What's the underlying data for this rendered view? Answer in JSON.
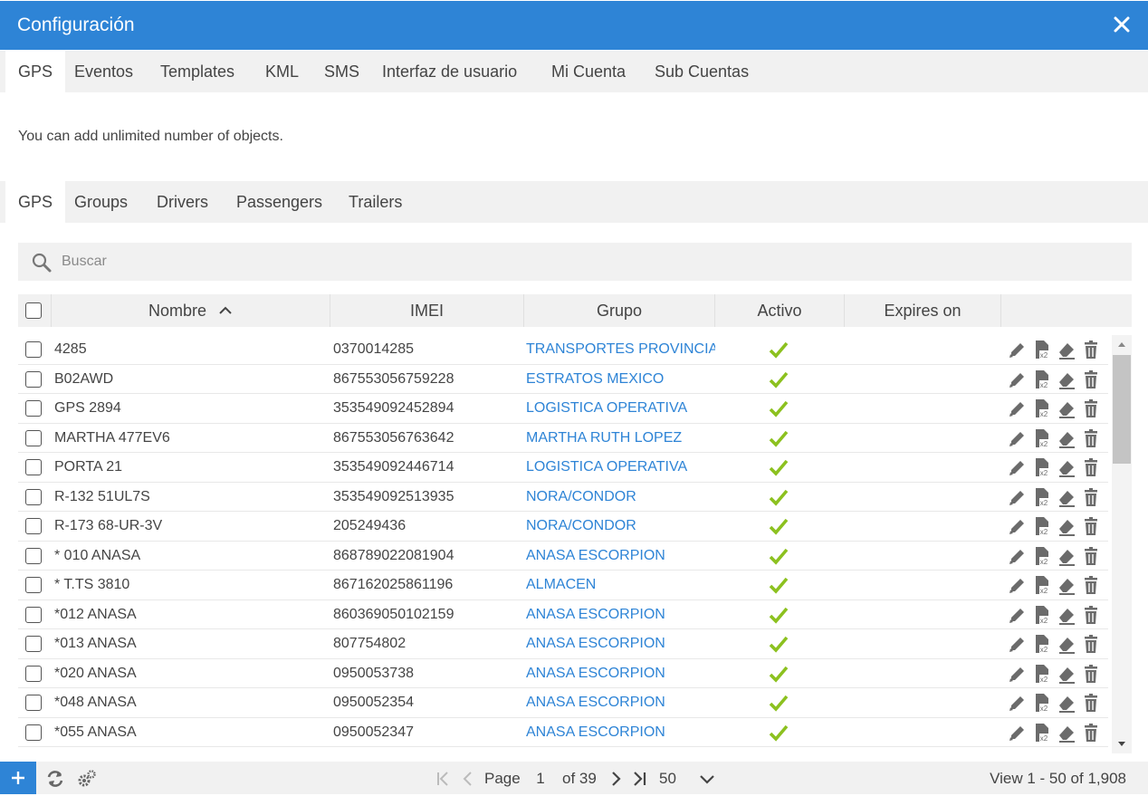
{
  "window": {
    "title": "Configuración"
  },
  "main_tabs": [
    "GPS",
    "Eventos",
    "Templates",
    "KML",
    "SMS",
    "Interfaz de usuario",
    "Mi Cuenta",
    "Sub Cuentas"
  ],
  "info_text": "You can add unlimited number of objects.",
  "sub_tabs": [
    "GPS",
    "Groups",
    "Drivers",
    "Passengers",
    "Trailers"
  ],
  "search": {
    "placeholder": "Buscar"
  },
  "table": {
    "columns": [
      "Nombre",
      "IMEI",
      "Grupo",
      "Activo",
      "Expires on"
    ],
    "rows": [
      {
        "nombre": "4285",
        "imei": "0370014285",
        "grupo": "TRANSPORTES PROVINCIAN",
        "activo": true,
        "expires": ""
      },
      {
        "nombre": "B02AWD",
        "imei": "867553056759228",
        "grupo": "ESTRATOS MEXICO",
        "activo": true,
        "expires": ""
      },
      {
        "nombre": "GPS 2894",
        "imei": "353549092452894",
        "grupo": "LOGISTICA OPERATIVA",
        "activo": true,
        "expires": ""
      },
      {
        "nombre": "MARTHA 477EV6",
        "imei": "867553056763642",
        "grupo": "MARTHA RUTH LOPEZ",
        "activo": true,
        "expires": ""
      },
      {
        "nombre": "PORTA 21",
        "imei": "353549092446714",
        "grupo": "LOGISTICA OPERATIVA",
        "activo": true,
        "expires": ""
      },
      {
        "nombre": "R-132 51UL7S",
        "imei": "353549092513935",
        "grupo": "NORA/CONDOR",
        "activo": true,
        "expires": ""
      },
      {
        "nombre": "R-173 68-UR-3V",
        "imei": "205249436",
        "grupo": "NORA/CONDOR",
        "activo": true,
        "expires": ""
      },
      {
        "nombre": "* 010  ANASA",
        "imei": "868789022081904",
        "grupo": "ANASA ESCORPION",
        "activo": true,
        "expires": ""
      },
      {
        "nombre": "* T.TS 3810",
        "imei": "867162025861196",
        "grupo": "ALMACEN",
        "activo": true,
        "expires": ""
      },
      {
        "nombre": "*012 ANASA",
        "imei": "860369050102159",
        "grupo": "ANASA ESCORPION",
        "activo": true,
        "expires": ""
      },
      {
        "nombre": "*013 ANASA",
        "imei": "807754802",
        "grupo": "ANASA ESCORPION",
        "activo": true,
        "expires": ""
      },
      {
        "nombre": "*020  ANASA",
        "imei": "0950053738",
        "grupo": "ANASA ESCORPION",
        "activo": true,
        "expires": ""
      },
      {
        "nombre": "*048 ANASA",
        "imei": "0950052354",
        "grupo": "ANASA ESCORPION",
        "activo": true,
        "expires": ""
      },
      {
        "nombre": "*055 ANASA",
        "imei": "0950052347",
        "grupo": "ANASA ESCORPION",
        "activo": true,
        "expires": ""
      }
    ]
  },
  "pager": {
    "page_label": "Page",
    "page_value": "1",
    "of_pages": "of 39",
    "per_page": "50",
    "summary": "View 1 - 50 of 1,908"
  },
  "colors": {
    "accent": "#2e84d6",
    "check": "#8cc11f",
    "icon": "#6b6b6b"
  }
}
